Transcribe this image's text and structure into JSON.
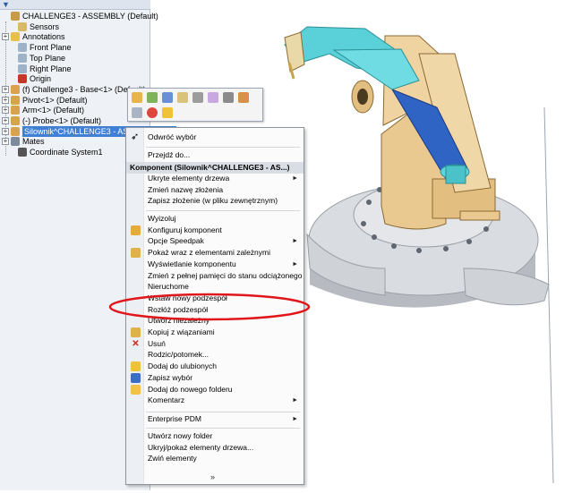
{
  "tree": {
    "toolbar_icon": "filter-icon",
    "items": [
      {
        "label": "CHALLENGE3 - ASSEMBLY  (Default)",
        "icon": "assembly-icon",
        "expander": "",
        "color": "#c79b4a"
      },
      {
        "label": "Sensors",
        "icon": "sensors-icon",
        "expander": "",
        "color": "#d8b86a"
      },
      {
        "label": "Annotations",
        "icon": "annotations-icon",
        "expander": "+",
        "color": "#e6c04a"
      },
      {
        "label": "Front Plane",
        "icon": "plane-icon",
        "expander": "",
        "color": "#9fb3c8"
      },
      {
        "label": "Top Plane",
        "icon": "plane-icon",
        "expander": "",
        "color": "#9fb3c8"
      },
      {
        "label": "Right Plane",
        "icon": "plane-icon",
        "expander": "",
        "color": "#9fb3c8"
      },
      {
        "label": "Origin",
        "icon": "origin-icon",
        "expander": "",
        "color": "#c0392b"
      },
      {
        "label": "(f) Challenge3 - Base<1> (Default)",
        "icon": "part-icon",
        "expander": "+",
        "color": "#d4a54a"
      },
      {
        "label": "Pivot<1> (Default)",
        "icon": "part-icon",
        "expander": "+",
        "color": "#d4a54a"
      },
      {
        "label": "Arm<1> (Default)",
        "icon": "part-icon",
        "expander": "+",
        "color": "#d4a54a"
      },
      {
        "label": "(-) Probe<1> (Default)",
        "icon": "part-icon",
        "expander": "+",
        "color": "#d4a54a"
      },
      {
        "label": "Silownik^CHALLENGE3 - ASSEMBLY<1>",
        "icon": "subassembly-icon",
        "expander": "+",
        "color": "#d4a54a"
      },
      {
        "label": "Mates",
        "icon": "mates-icon",
        "expander": "+",
        "color": "#7c8a9c"
      },
      {
        "label": "Coordinate System1",
        "icon": "coordinate-system-icon",
        "expander": "",
        "color": "#555555"
      }
    ]
  },
  "context_toolbar": {
    "row1": [
      "open-part-icon",
      "edit-assembly-icon",
      "smart-mate-icon",
      "hide-icon",
      "suppress-icon",
      "transparency-icon",
      "mate-icon",
      "properties-icon"
    ],
    "row2": [
      "zoom-to-selection-icon",
      "appearance-icon",
      "color-icon"
    ]
  },
  "menu": {
    "undo_select": "Odwróć wybór",
    "goto": "Przejdź do...",
    "header": "Komponent (Silownik^CHALLENGE3 - AS...)",
    "items_a": [
      {
        "label": "Ukryte elementy drzewa",
        "submenu": true,
        "icon": ""
      },
      {
        "label": "Zmień nazwę złożenia",
        "submenu": false,
        "icon": ""
      },
      {
        "label": "Zapisz złożenie (w pliku zewnętrznym)",
        "submenu": false,
        "icon": ""
      }
    ],
    "items_b": [
      {
        "label": "Wyizoluj",
        "submenu": false,
        "icon": ""
      },
      {
        "label": "Konfiguruj komponent",
        "submenu": false,
        "icon": "configure-icon"
      },
      {
        "label": "Opcje Speedpak",
        "submenu": true,
        "icon": ""
      },
      {
        "label": "Pokaż wraz z elementami zależnymi",
        "submenu": false,
        "icon": "show-with-dependents-icon"
      },
      {
        "label": "Wyświetlanie komponentu",
        "submenu": true,
        "icon": ""
      },
      {
        "label": "Zmień z pełnej pamięci do stanu odciążonego",
        "submenu": false,
        "icon": ""
      },
      {
        "label": "Nieruchome",
        "submenu": false,
        "icon": ""
      },
      {
        "label": "Wstaw nowy podzespół",
        "submenu": false,
        "icon": ""
      },
      {
        "label": "Rozłóż podzespół",
        "submenu": false,
        "icon": ""
      },
      {
        "label": "Utwórz niezależny",
        "submenu": false,
        "icon": ""
      },
      {
        "label": "Kopiuj z wiązaniami",
        "submenu": false,
        "icon": "copy-with-mates-icon"
      },
      {
        "label": "Usuń",
        "submenu": false,
        "icon": "delete-icon"
      },
      {
        "label": "Rodzic/potomek...",
        "submenu": false,
        "icon": ""
      },
      {
        "label": "Dodaj do ulubionych",
        "submenu": false,
        "icon": "favorites-icon"
      },
      {
        "label": "Zapisz wybór",
        "submenu": false,
        "icon": "save-selection-icon"
      },
      {
        "label": "Dodaj do nowego folderu",
        "submenu": false,
        "icon": "folder-icon"
      },
      {
        "label": "Komentarz",
        "submenu": true,
        "icon": ""
      }
    ],
    "items_c": [
      {
        "label": "Enterprise PDM",
        "submenu": true,
        "icon": ""
      }
    ],
    "items_d": [
      {
        "label": "Utwórz nowy folder",
        "submenu": false,
        "icon": ""
      },
      {
        "label": "Ukryj/pokaż elementy drzewa...",
        "submenu": false,
        "icon": ""
      },
      {
        "label": "Zwiń elementy",
        "submenu": false,
        "icon": ""
      }
    ],
    "more": "»"
  },
  "colors": {
    "selection": "#3f7fd4",
    "highlight_ellipse": "#e0161b",
    "wood": "#e9c98f",
    "wood_dark": "#b98b45",
    "cyan": "#5ad0d8",
    "blue_cylinder": "#2f63c4",
    "metal": "#c9ccd1"
  }
}
